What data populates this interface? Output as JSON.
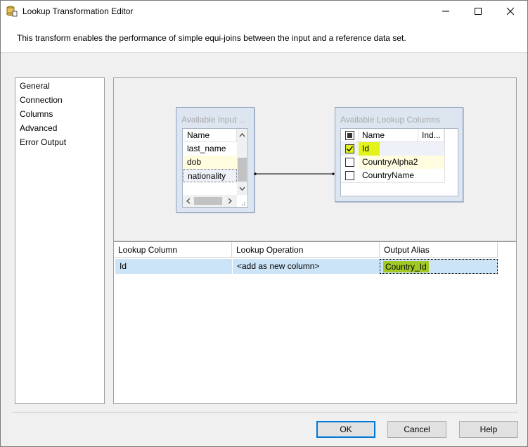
{
  "window": {
    "title": "Lookup Transformation Editor",
    "intro": "This transform enables the performance of simple equi-joins between the input and a reference data set."
  },
  "nav": {
    "items": [
      "General",
      "Connection",
      "Columns",
      "Advanced",
      "Error Output"
    ],
    "selected": "Columns"
  },
  "input_table": {
    "title": "Available Input ...",
    "header": "Name",
    "rows": [
      "last_name",
      "dob",
      "nationality"
    ]
  },
  "lookup_table": {
    "title": "Available Lookup Columns",
    "headers": [
      "Name",
      "Ind..."
    ],
    "rows": [
      {
        "name": "Id",
        "checked": true
      },
      {
        "name": "CountryAlpha2",
        "checked": false
      },
      {
        "name": "CountryName",
        "checked": false
      }
    ]
  },
  "mapping": {
    "headers": [
      "Lookup Column",
      "Lookup Operation",
      "Output Alias"
    ],
    "rows": [
      {
        "lookup_column": "Id",
        "operation": "<add as new column>",
        "alias": "Country_Id"
      }
    ]
  },
  "buttons": {
    "ok": "OK",
    "cancel": "Cancel",
    "help": "Help"
  },
  "colors": {
    "highlight": "#e2f31a",
    "selection": "#cce4f7",
    "accent": "#0078d7"
  }
}
